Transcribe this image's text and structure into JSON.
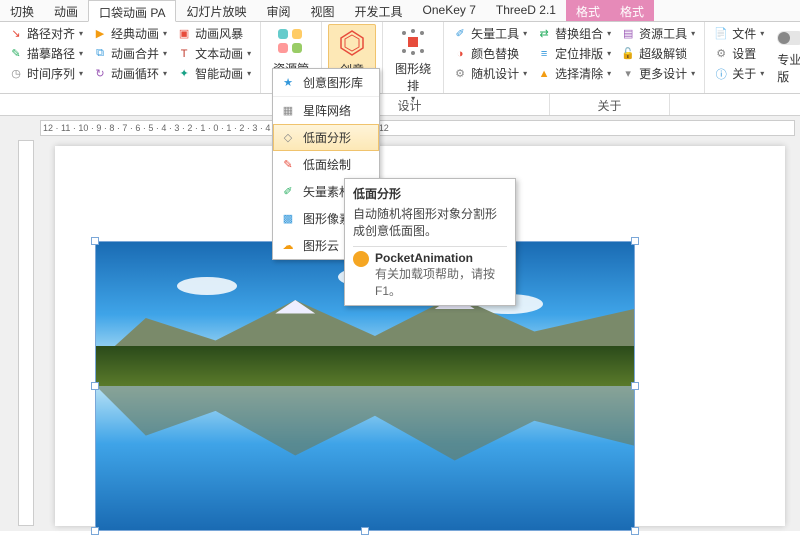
{
  "tabs": [
    "切换",
    "动画",
    "口袋动画 PA",
    "幻灯片放映",
    "审阅",
    "视图",
    "开发工具",
    "OneKey 7",
    "ThreeD 2.1",
    "格式",
    "格式"
  ],
  "active_tab_index": 2,
  "ribbon": {
    "group1": {
      "items": [
        "路径对齐",
        "经典动画",
        "动画风暴",
        "描摹路径",
        "动画合并",
        "文本动画",
        "时间序列",
        "动画循环",
        "智能动画"
      ]
    },
    "group2": {
      "label": "资源管理"
    },
    "group3": {
      "label": "创意图形"
    },
    "group4": {
      "label": "图形绕排"
    },
    "group5": {
      "items": [
        "矢量工具",
        "替换组合",
        "资源工具",
        "颜色替换",
        "定位排版",
        "超级解锁",
        "随机设计",
        "选择清除",
        "更多设计"
      ],
      "label": "设计"
    },
    "group6": {
      "items": [
        "文件",
        "设置",
        "关于"
      ],
      "toggle_label": "专业版",
      "label": "关于"
    }
  },
  "dropdown": {
    "items": [
      "创意图形库",
      "星阵网络",
      "低面分形",
      "低面绘制",
      "矢量素材",
      "图形像素",
      "图形云"
    ],
    "hover_index": 2
  },
  "tooltip": {
    "title": "低面分形",
    "body": "自动随机将图形对象分割形成创意低面图。",
    "brand": "PocketAnimation",
    "help": "有关加载项帮助，请按 F1。"
  },
  "ruler_text": "12 · 11 · 10 · 9 · 8 · 7 · 6 · 5 · 4 · 3 · 2 · 1 · 0 · 1 · 2 · 3 · 4 · 5 · 6 · 7 · 8 · 9 · 10 · 11 · 12",
  "sub_tabs": [
    "设计",
    "关于"
  ],
  "icons": {
    "path_align": "↘",
    "classic": "▶",
    "storm": "▣",
    "trace": "✎",
    "merge": "⧉",
    "text": "T",
    "time": "◷",
    "loop": "↻",
    "smart": "✦",
    "res_mgr": "▦",
    "creative": "✱",
    "wrap": "◫",
    "vector": "✐",
    "replace": "⇄",
    "res_tool": "▤",
    "color": "◑",
    "align": "≡",
    "unlock": "🔓",
    "random": "⚙",
    "clear": "▲",
    "more": "▾",
    "file": "📄",
    "settings": "⚙",
    "about": "ⓘ",
    "star": "★",
    "grid": "▦",
    "poly": "◇",
    "draw": "✎",
    "vec": "✐",
    "pixel": "▩",
    "cloud": "☁"
  }
}
